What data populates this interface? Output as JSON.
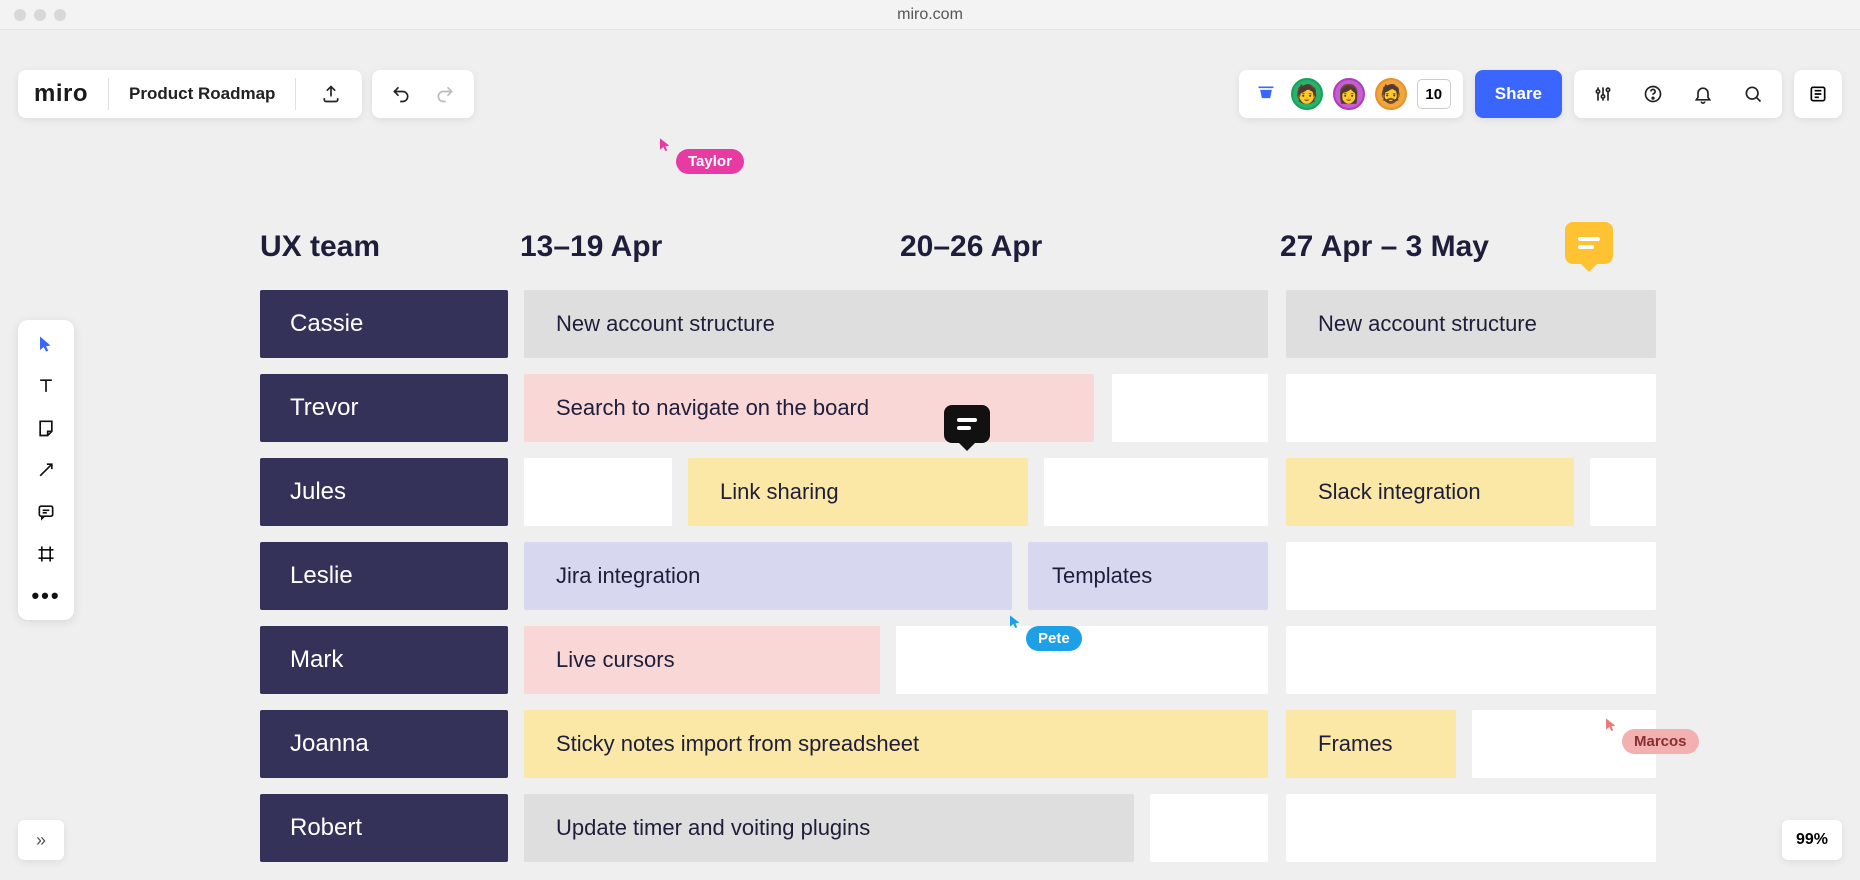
{
  "url": "miro.com",
  "brand": "miro",
  "board_title": "Product Roadmap",
  "share_label": "Share",
  "presence_count": "10",
  "zoom_label": "99%",
  "cursors": {
    "taylor": "Taylor",
    "pete": "Pete",
    "marcos": "Marcos"
  },
  "headers": {
    "team": "UX team",
    "col1": "13–19 Apr",
    "col2": "20–26 Apr",
    "col3": "27 Apr – 3 May"
  },
  "people": {
    "r0": "Cassie",
    "r1": "Trevor",
    "r2": "Jules",
    "r3": "Leslie",
    "r4": "Mark",
    "r5": "Joanna",
    "r6": "Robert"
  },
  "tasks": {
    "r0a": "New account structure",
    "r0b": "New account structure",
    "r1a": "Search to navigate on the board",
    "r2a": "Link sharing",
    "r2b": "Slack integration",
    "r3a": "Jira integration",
    "r3b": "Templates",
    "r4a": "Live cursors",
    "r5a": "Sticky notes import from spreadsheet",
    "r5b": "Frames",
    "r6a": "Update timer and voiting plugins"
  }
}
